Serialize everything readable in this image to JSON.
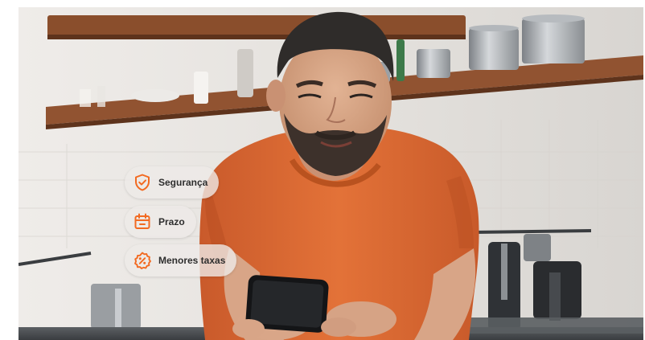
{
  "badges": [
    {
      "label": "Segurança",
      "icon": "shield-check-icon"
    },
    {
      "label": "Prazo",
      "icon": "calendar-icon"
    },
    {
      "label": "Menores taxas",
      "icon": "discount-percent-icon"
    }
  ],
  "colors": {
    "accent": "#f26a21",
    "shirt": "#e06a34",
    "shelf": "#8a4e2c",
    "wall": "#e6e3df"
  }
}
